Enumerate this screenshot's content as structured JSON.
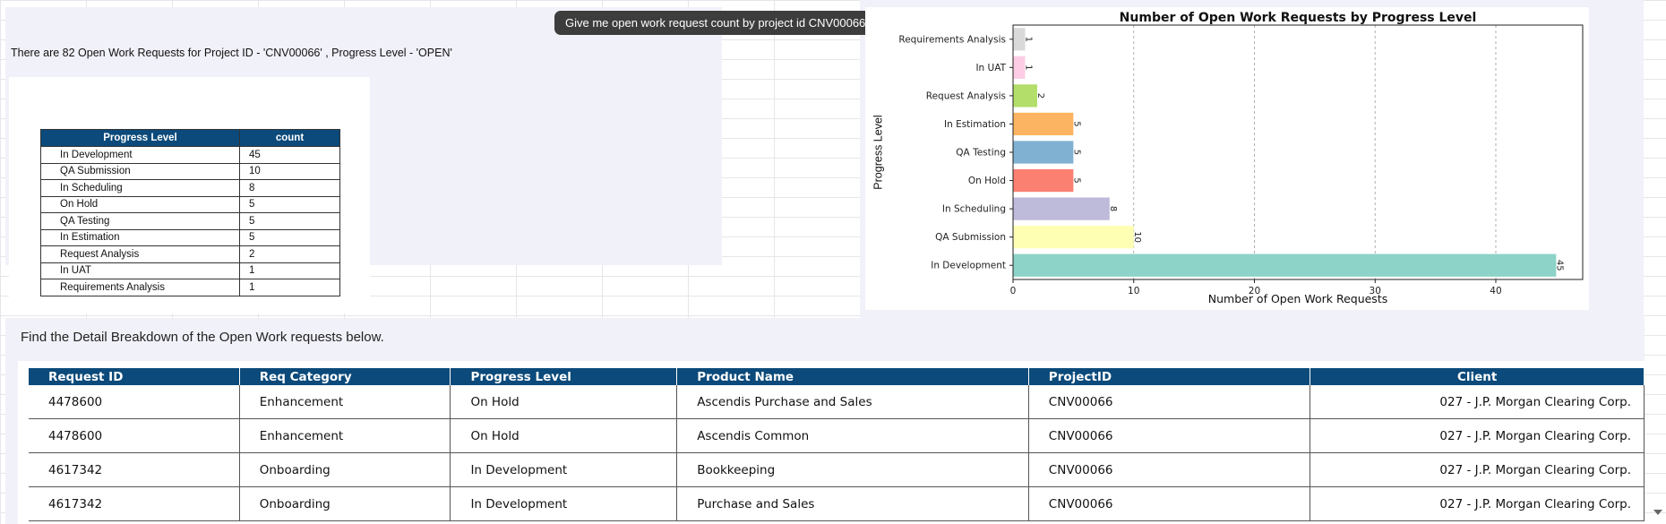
{
  "user_message": "Give me open work request count by project id CNV00066",
  "summary_text": "There are 82 Open Work Requests for Project ID - 'CNV00066' , Progress Level - 'OPEN'",
  "level_table": {
    "headers": [
      "Progress Level",
      "count"
    ],
    "rows": [
      [
        "In Development",
        "45"
      ],
      [
        "QA Submission",
        "10"
      ],
      [
        "In Scheduling",
        "8"
      ],
      [
        "On Hold",
        "5"
      ],
      [
        "QA Testing",
        "5"
      ],
      [
        "In Estimation",
        "5"
      ],
      [
        "Request Analysis",
        "2"
      ],
      [
        "In UAT",
        "1"
      ],
      [
        "Requirements Analysis",
        "1"
      ]
    ]
  },
  "chart_data": {
    "type": "bar",
    "orientation": "horizontal",
    "title": "Number of Open Work Requests by Progress Level",
    "xlabel": "Number of Open Work Requests",
    "ylabel": "Progress Level",
    "categories": [
      "In Development",
      "QA Submission",
      "In Scheduling",
      "On Hold",
      "QA Testing",
      "In Estimation",
      "Request Analysis",
      "In UAT",
      "Requirements Analysis"
    ],
    "values": [
      45,
      10,
      8,
      5,
      5,
      5,
      2,
      1,
      1
    ],
    "colors": [
      "#8dd3c7",
      "#ffffb3",
      "#bebada",
      "#fb8072",
      "#80b1d3",
      "#fdb462",
      "#b3de69",
      "#fccde5",
      "#d9d9d9"
    ],
    "xlim": [
      0,
      47.2
    ],
    "xticks": [
      0,
      10,
      20,
      30,
      40
    ],
    "grid": "x-dashed",
    "data_labels": true
  },
  "detail_heading": "Find the Detail Breakdown of the Open Work requests below.",
  "detail_table": {
    "headers": [
      "Request ID",
      "Req Category",
      "Progress Level",
      "Product Name",
      "ProjectID",
      "Client"
    ],
    "rows": [
      [
        "4478600",
        "Enhancement",
        "On Hold",
        "Ascendis Purchase and Sales",
        "CNV00066",
        "027 - J.P. Morgan Clearing Corp."
      ],
      [
        "4478600",
        "Enhancement",
        "On Hold",
        "Ascendis Common",
        "CNV00066",
        "027 - J.P. Morgan Clearing Corp."
      ],
      [
        "4617342",
        "Onboarding",
        "In Development",
        "Bookkeeping",
        "CNV00066",
        "027 - J.P. Morgan Clearing Corp."
      ],
      [
        "4617342",
        "Onboarding",
        "In Development",
        "Purchase and Sales",
        "CNV00066",
        "027 - J.P. Morgan Clearing Corp."
      ]
    ]
  }
}
